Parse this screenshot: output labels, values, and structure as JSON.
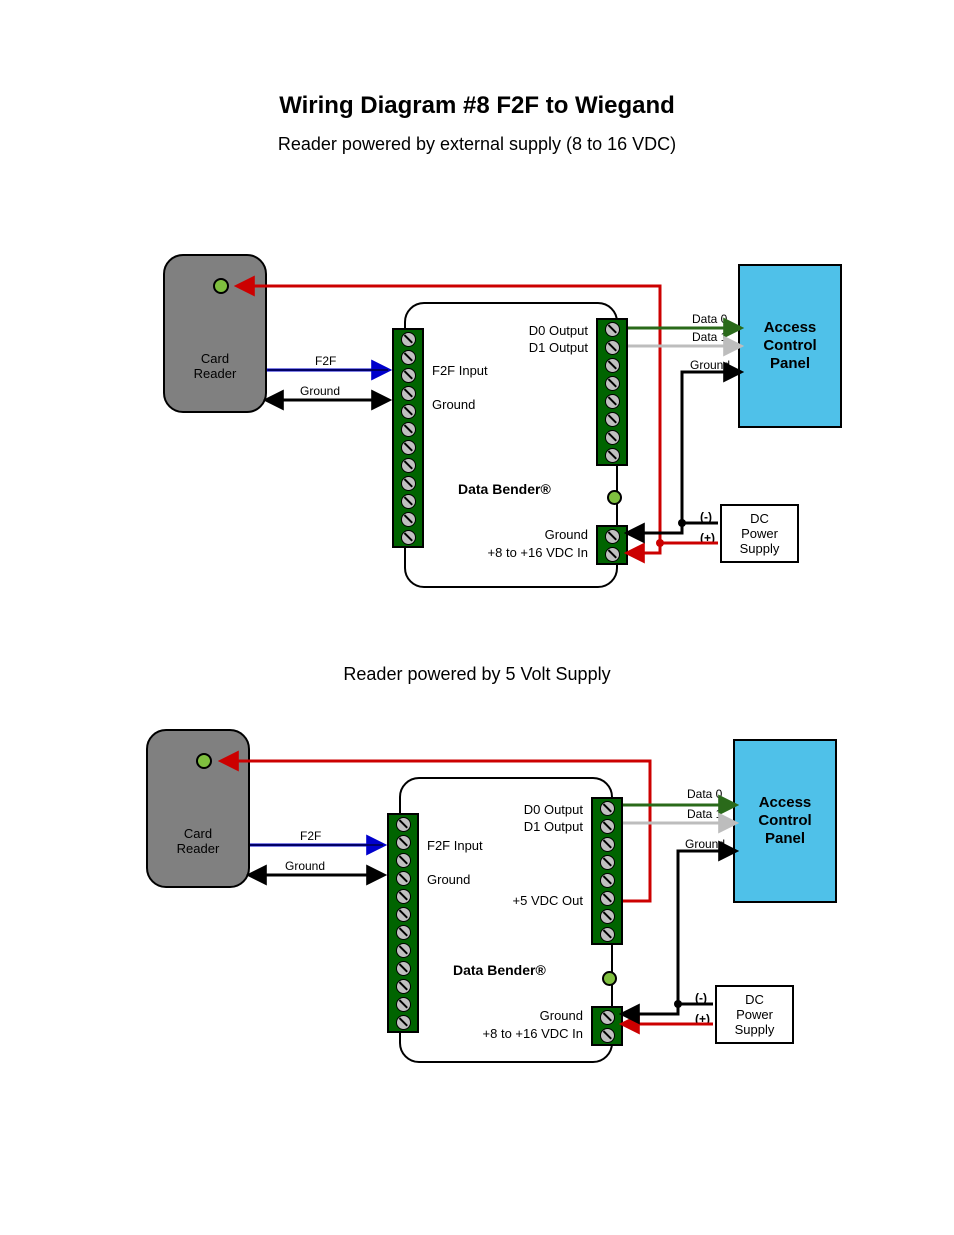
{
  "title": "Wiring Diagram  #8 F2F to Wiegand",
  "subtitle1": "Reader powered by external supply (8 to 16 VDC)",
  "subtitle2": "Reader powered by 5 Volt Supply",
  "card_reader_label": "Card\nReader",
  "data_bender_label": "Data Bender®",
  "acp_label": "Access\nControl\nPanel",
  "psu_label": "DC\nPower\nSupply",
  "pins": {
    "f2f_input": "F2F Input",
    "ground": "Ground",
    "d0_out": "D0 Output",
    "d1_out": "D1 Output",
    "plus5_out": "+5 VDC Out",
    "vdc_in": "+8 to +16 VDC In"
  },
  "wires": {
    "f2f": "F2F",
    "ground": "Ground",
    "data0": "Data 0",
    "data1": "Data 1",
    "minus": "(-)",
    "plus": "(+)"
  }
}
